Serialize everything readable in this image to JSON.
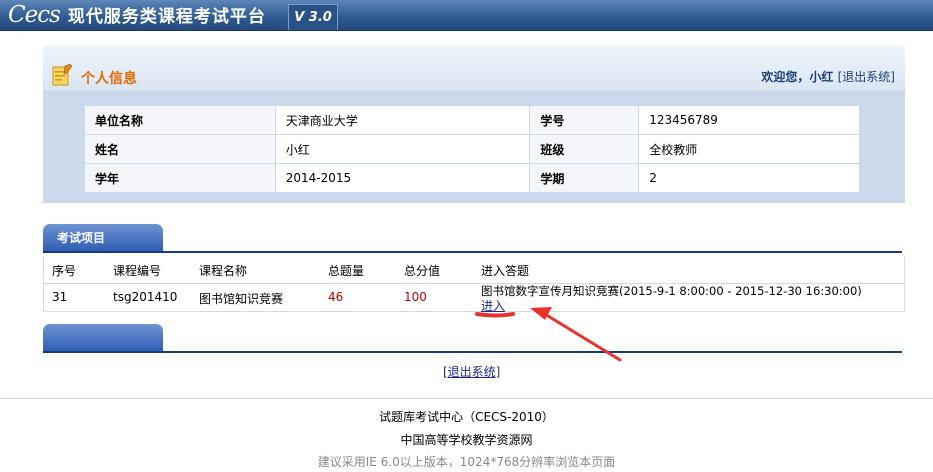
{
  "app": {
    "logo_text": "Cecs",
    "title": "现代服务类课程考试平台",
    "version": "V 3.0"
  },
  "info_panel": {
    "title": "个人信息",
    "welcome_prefix": "欢迎您，",
    "user_name": "小红",
    "logout_label": "[退出系统]",
    "rows": [
      {
        "label1": "单位名称",
        "value1": "天津商业大学",
        "label2": "学号",
        "value2": "123456789"
      },
      {
        "label1": "姓名",
        "value1": "小红",
        "label2": "班级",
        "value2": "全校教师"
      },
      {
        "label1": "学年",
        "value1": "2014-2015",
        "label2": "学期",
        "value2": "2"
      }
    ]
  },
  "exam_section": {
    "tab_label": "考试项目",
    "headers": {
      "no": "序号",
      "code": "课程编号",
      "name": "课程名称",
      "total_questions": "总题量",
      "total_score": "总分值",
      "enter": "进入答题"
    },
    "rows": [
      {
        "no": "31",
        "code": "tsg201410",
        "name": "图书馆知识竞赛",
        "total_questions": "46",
        "total_score": "100",
        "exam_title": "图书馆数字宣传月知识竞赛(2015-9-1 8:00:00 - 2015-12-30 16:30:00)",
        "enter_label": "进入"
      }
    ]
  },
  "second_section": {
    "tab_label": ""
  },
  "logout_bottom": "[退出系统]",
  "footer": {
    "line1": "试题库考试中心（CECS-2010）",
    "line2": "中国高等学校教学资源网",
    "line3": "建议采用IE 6.0以上版本，1024*768分辨率浏览本页面"
  },
  "colors": {
    "accent_orange": "#e36b00",
    "nav_blue": "#2f5c94",
    "annotation_red": "#e8322b",
    "value_red": "#c00000"
  }
}
